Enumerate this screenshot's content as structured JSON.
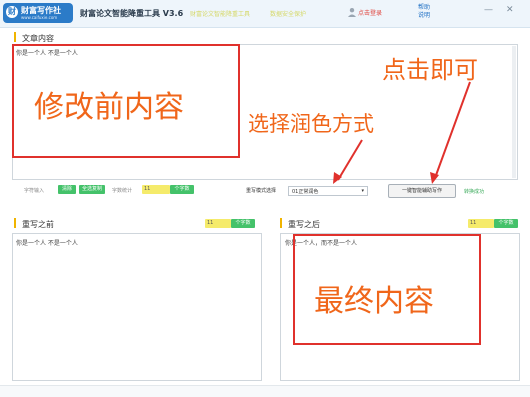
{
  "header": {
    "logo_mark": "财",
    "logo_name": "财富写作社",
    "logo_url": "www.caifuxie.com",
    "app_title": "财富论文智能降重工具 V3.6",
    "faint_text_1": "财富论文智能降重工具",
    "faint_text_2": "数据安全保护",
    "user_label": "点击登录",
    "help_label_1": "帮助",
    "help_label_2": "说明",
    "minimize": "—",
    "close": "✕"
  },
  "article": {
    "title": "文章内容",
    "content": "你是一个人  不是一个人",
    "annotation": "修改前内容"
  },
  "controls": {
    "left_label_1": "字符输入",
    "left_green_1": "清除",
    "left_green_2": "全选复制",
    "left_label_2": "字数统计",
    "counter_1": "11",
    "counter_btn_1": "个字数",
    "mode_label": "重写模式选择",
    "mode_selected": "01正常润色",
    "mode_caret": "▾",
    "main_button": "一键智能辅助写作",
    "status_link": "转换成功"
  },
  "annotations": {
    "choose_style": "选择润色方式",
    "click_now": "点击即可"
  },
  "before": {
    "title": "重写之前",
    "counter": "11",
    "counter_btn": "个字数",
    "content": "你是一个人  不是一个人"
  },
  "after": {
    "title": "重写之后",
    "counter": "11",
    "counter_btn": "个字数",
    "content": "你是一个人，而不是一个人",
    "annotation": "最终内容"
  },
  "colors": {
    "accent": "#2b7bc8",
    "highlight_red": "#e0312c",
    "handwriting_orange": "#f0661a",
    "green": "#44c26a",
    "yellow": "#f5eb6b"
  }
}
